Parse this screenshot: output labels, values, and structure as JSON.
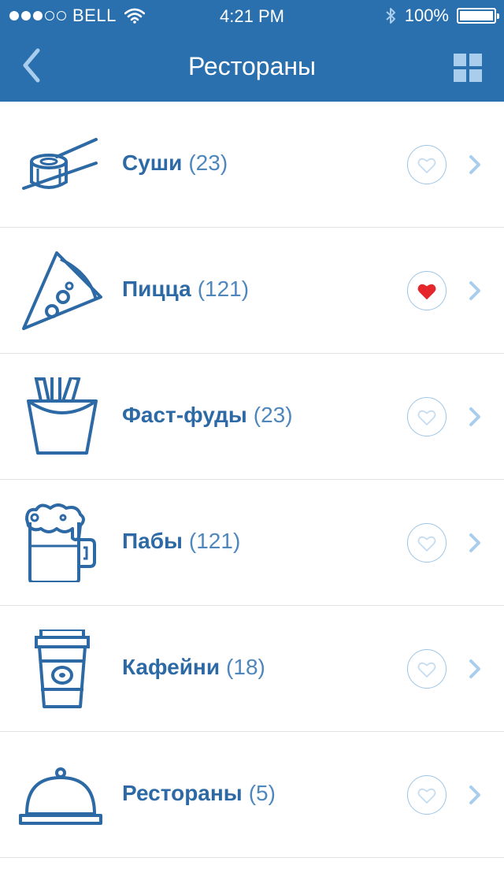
{
  "status_bar": {
    "signal_dots": [
      true,
      true,
      true,
      false,
      false
    ],
    "carrier": "BELL",
    "time": "4:21 PM",
    "battery": "100%",
    "battery_level": 1.0
  },
  "navbar": {
    "title": "Рестораны",
    "back_icon": "chevron-left-icon",
    "grid_icon": "grid-icon"
  },
  "colors": {
    "header": "#2a70ae",
    "accent": "#2d6aa5",
    "fav_active": "#e5262a",
    "fav_inactive": "#c6ddf1"
  },
  "categories": [
    {
      "name": "Суши",
      "count": "(23)",
      "icon": "sushi-icon",
      "favorite": false
    },
    {
      "name": "Пицца",
      "count": "(121)",
      "icon": "pizza-icon",
      "favorite": true
    },
    {
      "name": "Фаст-фуды",
      "count": "(23)",
      "icon": "fries-icon",
      "favorite": false
    },
    {
      "name": "Пабы",
      "count": "(121)",
      "icon": "beer-icon",
      "favorite": false
    },
    {
      "name": "Кафейни",
      "count": "(18)",
      "icon": "coffee-cup-icon",
      "favorite": false
    },
    {
      "name": "Рестораны",
      "count": "(5)",
      "icon": "cloche-icon",
      "favorite": false
    }
  ]
}
